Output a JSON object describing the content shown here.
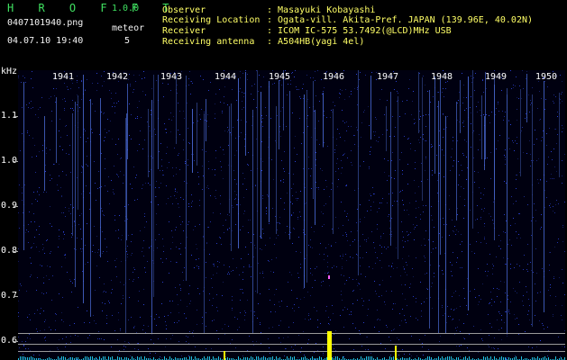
{
  "app": {
    "title": "H R O F F T",
    "version": "1.0.0"
  },
  "meta": {
    "filename": "0407101940.png",
    "datetime": "04.07.10 19:40",
    "meteor_label": "meteor",
    "meteor_count": "5"
  },
  "info": [
    {
      "key": "Observer",
      "value": ": Masayuki Kobayashi"
    },
    {
      "key": "Receiving Location",
      "value": ": Ogata-vill. Akita-Pref. JAPAN (139.96E, 40.02N)"
    },
    {
      "key": "Receiver",
      "value": ": ICOM IC-575 53.7492(@LCD)MHz USB"
    },
    {
      "key": "Receiving antenna",
      "value": ": A504HB(yagi 4el)"
    }
  ],
  "axis": {
    "y_unit": "kHz",
    "y_ticks": [
      "1.1",
      "1.0",
      "0.9",
      "0.8",
      "0.7",
      "0.6"
    ],
    "x_ticks": [
      "1941",
      "1942",
      "1943",
      "1944",
      "1945",
      "1946",
      "1947",
      "1948",
      "1949",
      "1950"
    ]
  },
  "colors": {
    "background": "#000000",
    "spectrum": "#2030d0",
    "trace": "#ffff00",
    "label_green": "#3fe060"
  }
}
